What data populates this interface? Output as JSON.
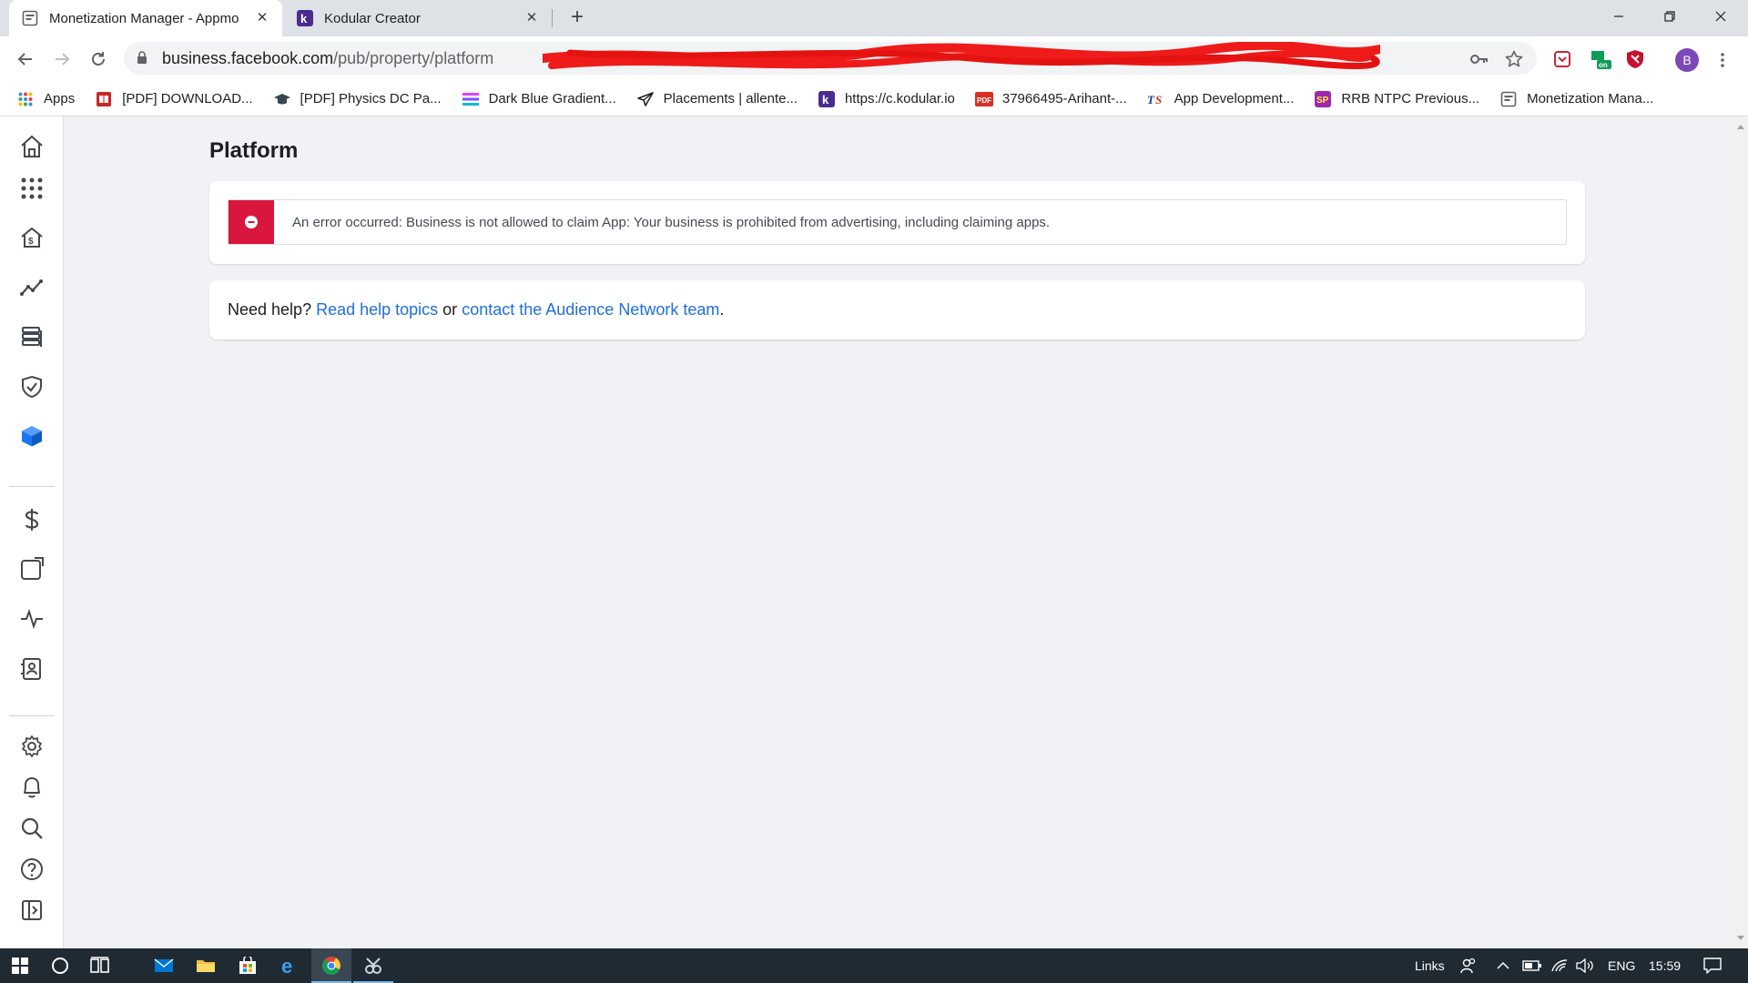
{
  "browser": {
    "tabs": [
      {
        "title": "Monetization Manager - Appmo",
        "favicon": "page-icon"
      },
      {
        "title": "Kodular Creator",
        "favicon": "kodular-k-icon"
      }
    ],
    "address": {
      "domain": "business.facebook.com",
      "path": "/pub/property/platform"
    },
    "profile_initial": "B",
    "bookmarks": [
      {
        "label": "Apps",
        "icon": "apps-grid-icon"
      },
      {
        "label": "[PDF] DOWNLOAD...",
        "icon": "book-icon"
      },
      {
        "label": "[PDF] Physics DC Pa...",
        "icon": "graduation-cap-icon"
      },
      {
        "label": "Dark Blue Gradient...",
        "icon": "gradient-icon"
      },
      {
        "label": "Placements | allente...",
        "icon": "send-icon"
      },
      {
        "label": "https://c.kodular.io",
        "icon": "kodular-k-icon"
      },
      {
        "label": "37966495-Arihant-...",
        "icon": "pdf-icon"
      },
      {
        "label": "App Development...",
        "icon": "ts-logo-icon"
      },
      {
        "label": "RRB NTPC Previous...",
        "icon": "sp-logo-icon"
      },
      {
        "label": "Monetization Mana...",
        "icon": "page-icon"
      }
    ],
    "colors": {
      "pdf_red": "#d93025",
      "brand_purple": "#7b48b8"
    }
  },
  "page": {
    "title": "Platform",
    "error_message": "An error occurred: Business is not allowed to claim App: Your business is prohibited from advertising, including claiming apps.",
    "help": {
      "prefix": "Need help? ",
      "link1": "Read help topics",
      "middle": " or ",
      "link2": "contact the Audience Network team",
      "suffix": "."
    },
    "colors": {
      "error_red": "#d8163e",
      "link_blue": "#216fdb",
      "active_nav": "#1877f2"
    }
  },
  "nav": {
    "items": [
      "home-icon",
      "apps-grid-icon",
      "property-house-icon",
      "trend-icon",
      "database-icon",
      "shield-check-icon",
      "integration-cube-icon",
      "dollar-icon",
      "placement-square-icon",
      "pulse-icon",
      "contact-book-icon",
      "settings-gear-icon",
      "bell-icon",
      "search-icon",
      "help-circle-icon",
      "collapse-sidebar-icon"
    ],
    "active": "integration-cube-icon"
  },
  "taskbar": {
    "links_label": "Links",
    "language": "ENG",
    "time": "15:59"
  }
}
